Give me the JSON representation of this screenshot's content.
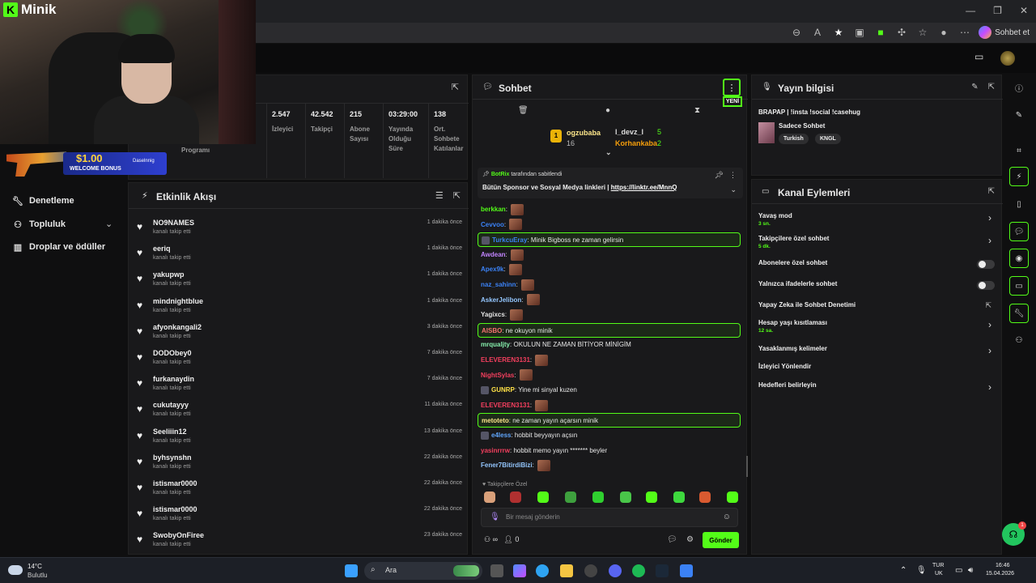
{
  "browser": {
    "copilot_label": "Sohbet et",
    "window_controls": [
      "—",
      "❐",
      "✕"
    ]
  },
  "webcam": {
    "brand": "Minik"
  },
  "promo": {
    "amount": "$1.00",
    "bonus": "WELCOME BONUS",
    "brand": "Daselnnig"
  },
  "nav": {
    "items": [
      {
        "label": "Denetleme",
        "icon": "wrench-icon"
      },
      {
        "label": "Topluluk",
        "icon": "community-icon"
      },
      {
        "label": "Droplar ve ödüller",
        "icon": "chart-icon"
      }
    ]
  },
  "stats": {
    "programi": "Programı",
    "items": [
      {
        "value": "2.547",
        "label": "İzleyici"
      },
      {
        "value": "42.542",
        "label": "Takipçi"
      },
      {
        "value": "215",
        "label": "Abone Sayısı"
      },
      {
        "value": "03:29:00",
        "label": "Yayında Olduğu Süre"
      },
      {
        "value": "138",
        "label": "Ort. Sohbete Katılanlar"
      }
    ]
  },
  "activity": {
    "title": "Etkinlik Akışı",
    "rows": [
      {
        "name": "NO9NAMES",
        "action": "kanalı takip etti",
        "time": "1 dakika önce"
      },
      {
        "name": "eeriq",
        "action": "kanalı takip etti",
        "time": "1 dakika önce"
      },
      {
        "name": "yakupwp",
        "action": "kanalı takip etti",
        "time": "1 dakika önce"
      },
      {
        "name": "mindnightblue",
        "action": "kanalı takip etti",
        "time": "1 dakika önce"
      },
      {
        "name": "afyonkangali2",
        "action": "kanalı takip etti",
        "time": "3 dakika önce"
      },
      {
        "name": "DODObey0",
        "action": "kanalı takip etti",
        "time": "7 dakika önce"
      },
      {
        "name": "furkanaydin",
        "action": "kanalı takip etti",
        "time": "7 dakika önce"
      },
      {
        "name": "cukutayyy",
        "action": "kanalı takip etti",
        "time": "11 dakika önce"
      },
      {
        "name": "Seeliiin12",
        "action": "kanalı takip etti",
        "time": "13 dakika önce"
      },
      {
        "name": "byhsynshn",
        "action": "kanalı takip etti",
        "time": "22 dakika önce"
      },
      {
        "name": "istismar0000",
        "action": "kanalı takip etti",
        "time": "22 dakika önce"
      },
      {
        "name": "istismar0000",
        "action": "kanalı takip etti",
        "time": "22 dakika önce"
      },
      {
        "name": "SwobyOnFiree",
        "action": "kanalı takip etti",
        "time": "23 dakika önce"
      }
    ]
  },
  "chat": {
    "title": "Sohbet",
    "new_badge": "YENİ",
    "gifters": [
      {
        "rank": "1",
        "name": "ogzubaba",
        "count": "16"
      },
      {
        "name": "l_devz_l",
        "count": "5"
      },
      {
        "name": "Korhankaba",
        "count": "2"
      }
    ],
    "pinned": {
      "by_user": "BotRix",
      "by_suffix": " tarafından sabitlendi",
      "text": "Bütün Sponsor ve Sosyal Medya linkleri | ",
      "link": "https://linktr.ee/MnnQ"
    },
    "messages": [
      {
        "user": "berkkan",
        "color": "#53fc18",
        "text": "",
        "emote": true,
        "highlight": false
      },
      {
        "user": "Cevvoo",
        "color": "#3b82f6",
        "text": "",
        "emote": true,
        "highlight": false
      },
      {
        "user": "TurkcuEray",
        "color": "#3b82f6",
        "text": "Minik Bigboss ne zaman gelirsin",
        "emote": false,
        "highlight": true,
        "badge": true
      },
      {
        "user": "Awdean",
        "color": "#c084fc",
        "text": "",
        "emote": true,
        "highlight": false
      },
      {
        "user": "Apex9k",
        "color": "#3b82f6",
        "text": "",
        "emote": true,
        "highlight": false
      },
      {
        "user": "naz_sahinn",
        "color": "#3b82f6",
        "text": "",
        "emote": true,
        "highlight": false
      },
      {
        "user": "AskerJelibon",
        "color": "#93c5fd",
        "text": "",
        "emote": true,
        "highlight": false
      },
      {
        "user": "Yagixcs",
        "color": "#e5e5e5",
        "text": "",
        "emote": true,
        "highlight": false
      },
      {
        "user": "AISBO",
        "color": "#f87171",
        "text": "ne okuyon minik",
        "emote": false,
        "highlight": true
      },
      {
        "user": "mrqualjty",
        "color": "#86efac",
        "text": "OKULUN NE ZAMAN BİTİYOR MİNİGİM",
        "emote": false,
        "highlight": false
      },
      {
        "user": "ELEVEREN3131",
        "color": "#f43f5e",
        "text": "",
        "emote": true,
        "highlight": false
      },
      {
        "user": "NightSylas",
        "color": "#f43f5e",
        "text": "",
        "emote": true,
        "highlight": false
      },
      {
        "user": "GUNRP",
        "color": "#fde047",
        "text": "Yine mi sinyal kuzen",
        "emote": false,
        "highlight": false,
        "badge": true
      },
      {
        "user": "ELEVEREN3131",
        "color": "#f43f5e",
        "text": "",
        "emote": true,
        "highlight": false
      },
      {
        "user": "metoteto",
        "color": "#fde68a",
        "text": "ne zaman yayın açarsın minik",
        "emote": false,
        "highlight": true
      },
      {
        "user": "e4less",
        "color": "#60a5fa",
        "text": "hobbit beyyayın açsın",
        "emote": false,
        "highlight": false,
        "badge": true
      },
      {
        "user": "yasinrrrw",
        "color": "#f43f5e",
        "text": "hobbit memo yayın ******* beyler",
        "emote": false,
        "highlight": false
      },
      {
        "user": "Fener7BitirdiBizi",
        "color": "#93c5fd",
        "text": "",
        "emote": true,
        "highlight": false
      }
    ],
    "follow_only": "Takipçilere Özel",
    "input_placeholder": "Bir mesaj gönderin",
    "viewer_count": "0",
    "send_label": "Gönder"
  },
  "info": {
    "title": "Yayın bilgisi",
    "stream_title": "BRAPAP | !insta !social !casehug",
    "category": "Sadece Sohbet",
    "tags": [
      "Turkish",
      "KNGL"
    ]
  },
  "actions": {
    "title": "Kanal Eylemleri",
    "rows": [
      {
        "label": "Yavaş mod",
        "sub": "3 sn.",
        "control": "arrow"
      },
      {
        "label": "Takipçilere özel sohbet",
        "sub": "5 dk.",
        "control": "arrow"
      },
      {
        "label": "Abonelere özel sohbet",
        "sub": "",
        "control": "toggle"
      },
      {
        "label": "Yalnızca ifadelerle sohbet",
        "sub": "",
        "control": "toggle"
      },
      {
        "label": "Yapay Zeka ile Sohbet Denetimi",
        "sub": "",
        "control": "ext"
      },
      {
        "label": "Hesap yaşı kısıtlaması",
        "sub": "12 sa.",
        "control": "arrow"
      },
      {
        "label": "Yasaklanmış kelimeler",
        "sub": "",
        "control": "arrow"
      },
      {
        "label": "İzleyici Yönlendir",
        "sub": "",
        "control": "none"
      },
      {
        "label": "Hedefleri belirleyin",
        "sub": "",
        "control": "arrow"
      }
    ]
  },
  "taskbar": {
    "temp": "14°C",
    "condition": "Bulutlu",
    "search_placeholder": "Ara",
    "lang1": "TUR",
    "lang2": "UK",
    "time": "16:46",
    "date": "15.04.2026",
    "notif_count": "1"
  },
  "colors": {
    "accent": "#53fc18",
    "panel": "#19191b",
    "background": "#0f0f10"
  }
}
